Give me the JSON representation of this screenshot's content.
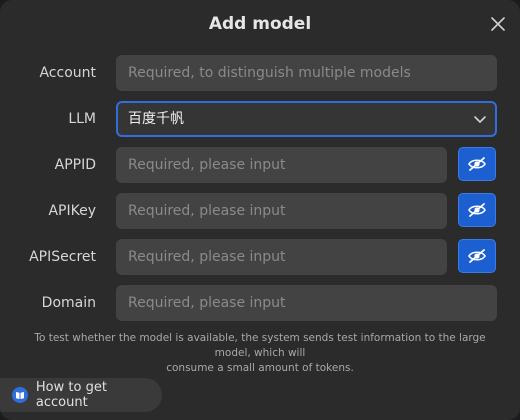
{
  "dialog": {
    "title": "Add model",
    "close_icon": "close-icon"
  },
  "fields": {
    "account": {
      "label": "Account",
      "placeholder": "Required, to distinguish multiple models"
    },
    "llm": {
      "label": "LLM",
      "value": "百度千帆",
      "icon": "chevron-down-icon"
    },
    "appid": {
      "label": "APPID",
      "placeholder": "Required, please input",
      "icon": "eye-off-icon"
    },
    "apikey": {
      "label": "APIKey",
      "placeholder": "Required, please input",
      "icon": "eye-off-icon"
    },
    "apisecret": {
      "label": "APISecret",
      "placeholder": "Required, please input",
      "icon": "eye-off-icon"
    },
    "domain": {
      "label": "Domain",
      "placeholder": "Required, please input"
    }
  },
  "note": {
    "line1": "To test whether the model is available, the system sends test information to the large model, which will",
    "line2": "consume a small amount of tokens."
  },
  "help": {
    "label": "How to get account",
    "icon": "book-icon"
  },
  "colors": {
    "accent": "#1c5fd0",
    "background": "#2b2b2b",
    "field": "#434343"
  }
}
